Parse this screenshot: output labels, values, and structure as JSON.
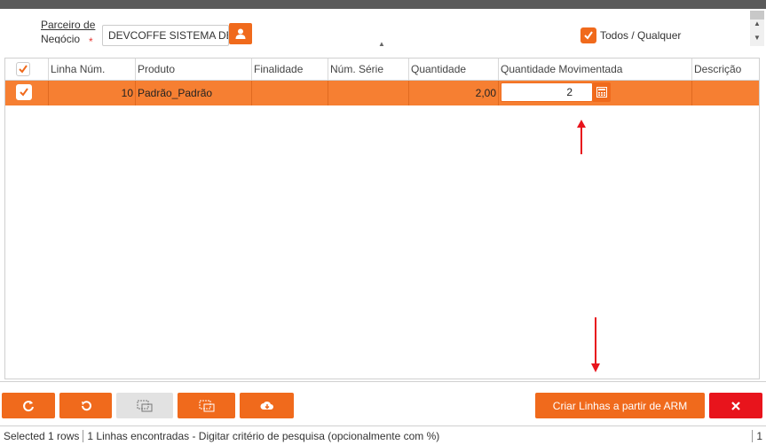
{
  "filter": {
    "partner_label": "Parceiro de",
    "partner_label_line2": "Negócio",
    "partner_value": "DEVCOFFE SISTEMA DE C",
    "todos_label": "Todos / Qualquer",
    "todos_checked": true
  },
  "grid": {
    "columns": [
      "Linha Núm.",
      "Produto",
      "Finalidade",
      "Núm. Série",
      "Quantidade",
      "Quantidade Movimentada",
      "Descrição"
    ],
    "rows": [
      {
        "selected": true,
        "linha_num": "10",
        "produto": "Padrão_Padrão",
        "finalidade": "",
        "num_serie": "",
        "quantidade": "2,00",
        "quantidade_movimentada": "2",
        "descricao": ""
      }
    ]
  },
  "toolbar": {
    "refresh_icon": "refresh-icon",
    "undo_icon": "undo-icon",
    "columns_icon": "columns-icon",
    "columns2_icon": "columns-icon",
    "download_icon": "cloud-download-icon",
    "create_lines_label": "Criar Linhas a partir de ARM",
    "close_icon": "close-icon"
  },
  "status": {
    "selected": "Selected 1 rows",
    "message": "1 Linhas encontradas - Digitar critério de pesquisa (opcionalmente com %)",
    "page": "1"
  },
  "colors": {
    "accent": "#f06a1c",
    "row_highlight": "#f67f32",
    "danger": "#e8141c"
  }
}
